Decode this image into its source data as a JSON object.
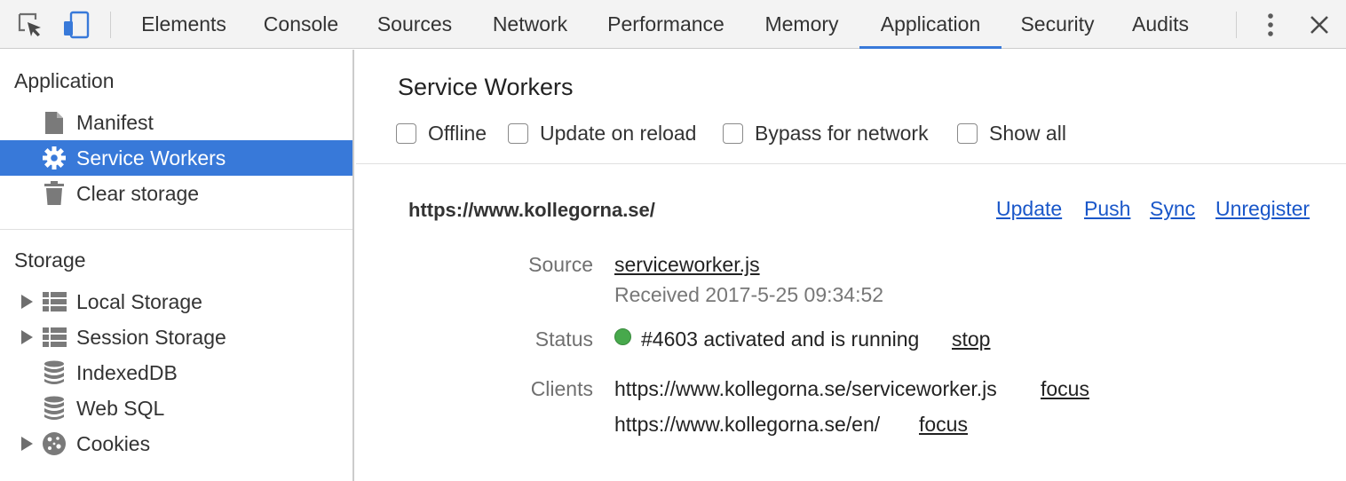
{
  "toolbar": {
    "inspect_icon": "inspect-cursor-icon",
    "device_icon": "device-toggle-icon",
    "tabs": [
      {
        "label": "Elements"
      },
      {
        "label": "Console"
      },
      {
        "label": "Sources"
      },
      {
        "label": "Network"
      },
      {
        "label": "Performance"
      },
      {
        "label": "Memory"
      },
      {
        "label": "Application",
        "active": true
      },
      {
        "label": "Security"
      },
      {
        "label": "Audits"
      }
    ],
    "more_icon": "vertical-ellipsis-icon",
    "close_icon": "close-icon",
    "accent_color": "#3879d9"
  },
  "sidebar": {
    "application_header": "Application",
    "application_items": [
      {
        "label": "Manifest",
        "icon": "file-icon"
      },
      {
        "label": "Service Workers",
        "icon": "gear-icon",
        "selected": true
      },
      {
        "label": "Clear storage",
        "icon": "trash-icon"
      }
    ],
    "storage_header": "Storage",
    "storage_items": [
      {
        "label": "Local Storage",
        "icon": "grid-icon",
        "expandable": true
      },
      {
        "label": "Session Storage",
        "icon": "grid-icon",
        "expandable": true
      },
      {
        "label": "IndexedDB",
        "icon": "database-icon",
        "expandable": false
      },
      {
        "label": "Web SQL",
        "icon": "database-icon",
        "expandable": false
      },
      {
        "label": "Cookies",
        "icon": "cookie-icon",
        "expandable": true
      }
    ],
    "selected_color": "#3879d9"
  },
  "main": {
    "title": "Service Workers",
    "options": [
      {
        "label": "Offline",
        "checked": false
      },
      {
        "label": "Update on reload",
        "checked": false
      },
      {
        "label": "Bypass for network",
        "checked": false
      },
      {
        "label": "Show all",
        "checked": false
      }
    ],
    "worker": {
      "origin": "https://www.kollegorna.se/",
      "actions": [
        "Update",
        "Push",
        "Sync",
        "Unregister"
      ],
      "source_label": "Source",
      "source_file": "serviceworker.js",
      "received": "Received 2017-5-25 09:34:52",
      "status_label": "Status",
      "status_text": "#4603 activated and is running",
      "status_color": "#47a94c",
      "stop_label": "stop",
      "clients_label": "Clients",
      "clients": [
        {
          "url": "https://www.kollegorna.se/serviceworker.js",
          "action": "focus"
        },
        {
          "url": "https://www.kollegorna.se/en/",
          "action": "focus"
        }
      ]
    }
  }
}
